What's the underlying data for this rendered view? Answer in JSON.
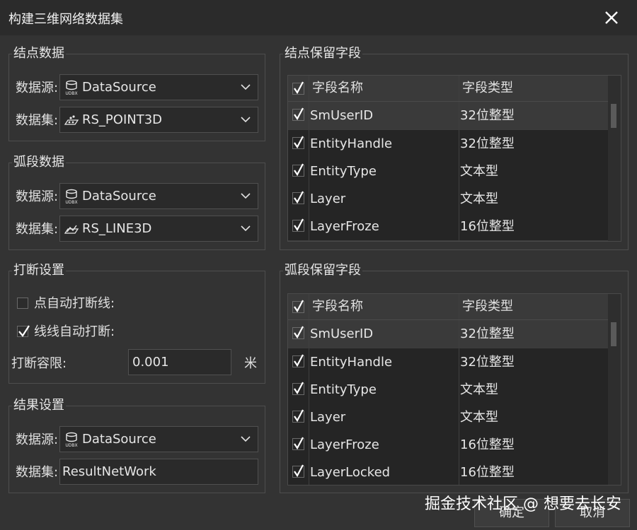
{
  "window": {
    "title": "构建三维网络数据集"
  },
  "node_data": {
    "title": "结点数据",
    "datasource_label": "数据源:",
    "datasource_value": "DataSource",
    "dataset_label": "数据集:",
    "dataset_value": "RS_POINT3D"
  },
  "arc_data": {
    "title": "弧段数据",
    "datasource_label": "数据源:",
    "datasource_value": "DataSource",
    "dataset_label": "数据集:",
    "dataset_value": "RS_LINE3D"
  },
  "break_settings": {
    "title": "打断设置",
    "auto_break_point": {
      "label": "点自动打断线:",
      "checked": false
    },
    "auto_break_line": {
      "label": "线线自动打断:",
      "checked": true
    },
    "tolerance_label": "打断容限:",
    "tolerance_value": "0.001",
    "tolerance_unit": "米"
  },
  "result_settings": {
    "title": "结果设置",
    "datasource_label": "数据源:",
    "datasource_value": "DataSource",
    "dataset_label": "数据集:",
    "dataset_value": "ResultNetWork"
  },
  "node_fields": {
    "title": "结点保留字段",
    "col_name": "字段名称",
    "col_type": "字段类型",
    "rows": [
      {
        "name": "SmUserID",
        "type": "32位整型"
      },
      {
        "name": "EntityHandle",
        "type": "32位整型"
      },
      {
        "name": "EntityType",
        "type": "文本型"
      },
      {
        "name": "Layer",
        "type": "文本型"
      },
      {
        "name": "LayerFroze",
        "type": "16位整型"
      }
    ]
  },
  "arc_fields": {
    "title": "弧段保留字段",
    "col_name": "字段名称",
    "col_type": "字段类型",
    "rows": [
      {
        "name": "SmUserID",
        "type": "32位整型"
      },
      {
        "name": "EntityHandle",
        "type": "32位整型"
      },
      {
        "name": "EntityType",
        "type": "文本型"
      },
      {
        "name": "Layer",
        "type": "文本型"
      },
      {
        "name": "LayerFroze",
        "type": "16位整型"
      },
      {
        "name": "LayerLocked",
        "type": "16位整型"
      }
    ]
  },
  "buttons": {
    "ok": "确定",
    "cancel": "取消"
  },
  "watermark": "掘金技术社区 @ 想要去长安",
  "colors": {
    "background": "#333333",
    "titlebar": "#2b2b2b",
    "text": "#e6e6e6"
  }
}
